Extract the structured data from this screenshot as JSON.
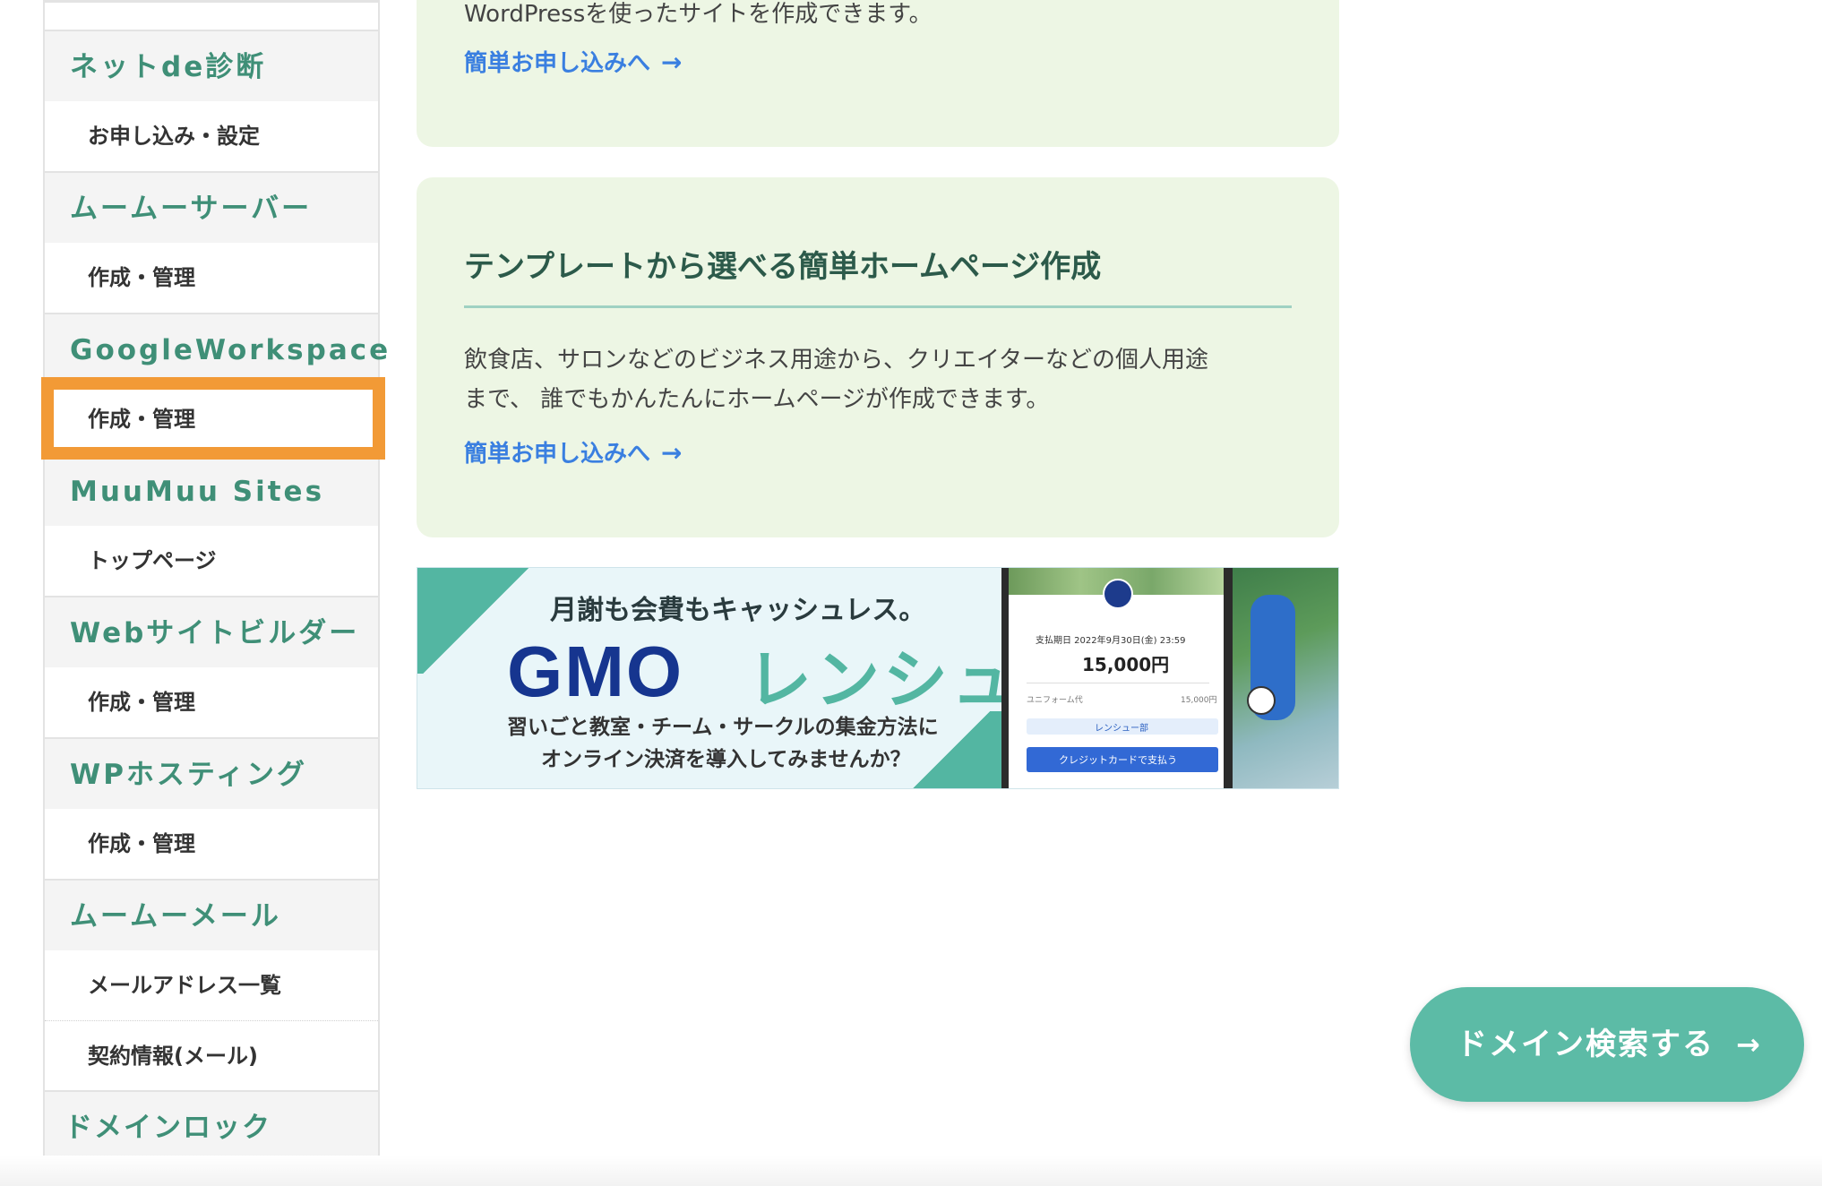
{
  "sidebar": {
    "sections": [
      {
        "title": "ネットde診断",
        "items": [
          "お申し込み・設定"
        ]
      },
      {
        "title": "ムームーサーバー",
        "items": [
          "作成・管理"
        ]
      },
      {
        "title": "GoogleWorkspace",
        "items": [
          "作成・管理"
        ]
      },
      {
        "title": "MuuMuu Sites",
        "items": [
          "トップページ"
        ]
      },
      {
        "title": "Webサイトビルダー",
        "items": [
          "作成・管理"
        ]
      },
      {
        "title": "WPホスティング",
        "items": [
          "作成・管理"
        ]
      },
      {
        "title": "ムームーメール",
        "items": [
          "メールアドレス一覧",
          "契約情報(メール)"
        ]
      },
      {
        "title": "ドメインロック",
        "items": []
      }
    ],
    "highlight_color": "#f29a36"
  },
  "cards": [
    {
      "text": "WordPressを使ったサイトを作成できます。",
      "link": "簡単お申し込みへ"
    },
    {
      "title": "テンプレートから選べる簡単ホームページ作成",
      "text_line1": "飲食店、サロンなどのビジネス用途から、クリエイターなどの個人用途",
      "text_line2": "まで、 誰でもかんたんにホームページが作成できます。",
      "link": "簡単お申し込みへ"
    }
  ],
  "banner": {
    "tagline": "月謝も会費もキャッシュレス。",
    "brand_gmo": "GMO",
    "brand_name": "レンシュ",
    "sub_line1": "習いごと教室・チーム・サークルの集金方法に",
    "sub_line2": "オンライン決済を導入してみませんか？",
    "phone": {
      "due": "支払期日 2022年9月30日(金) 23:59",
      "amount": "15,000円",
      "item": "ユニフォーム代",
      "item_amount": "15,000円",
      "pill": "レンシュー部",
      "button": "クレジットカードで支払う"
    }
  },
  "cta": {
    "label": "ドメイン検索する",
    "arrow": "→",
    "color": "#5cbba6"
  },
  "icons": {
    "link_arrow": "→"
  }
}
